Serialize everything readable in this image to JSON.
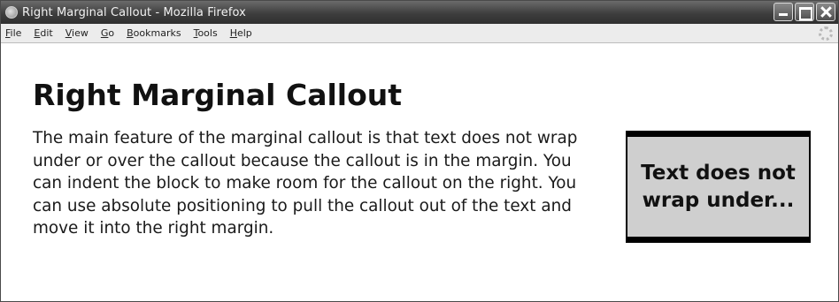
{
  "window": {
    "title": "Right Marginal Callout - Mozilla Firefox"
  },
  "menubar": {
    "items": [
      "File",
      "Edit",
      "View",
      "Go",
      "Bookmarks",
      "Tools",
      "Help"
    ]
  },
  "page": {
    "heading": "Right Marginal Callout",
    "paragraph": "The main feature of the marginal callout is that text does not wrap under or over the callout because the callout is in the margin. You can indent the block to make room for the callout on the right. You can use absolute positioning to pull the callout out of the text and move it into the right margin.",
    "callout": "Text does not wrap under..."
  }
}
